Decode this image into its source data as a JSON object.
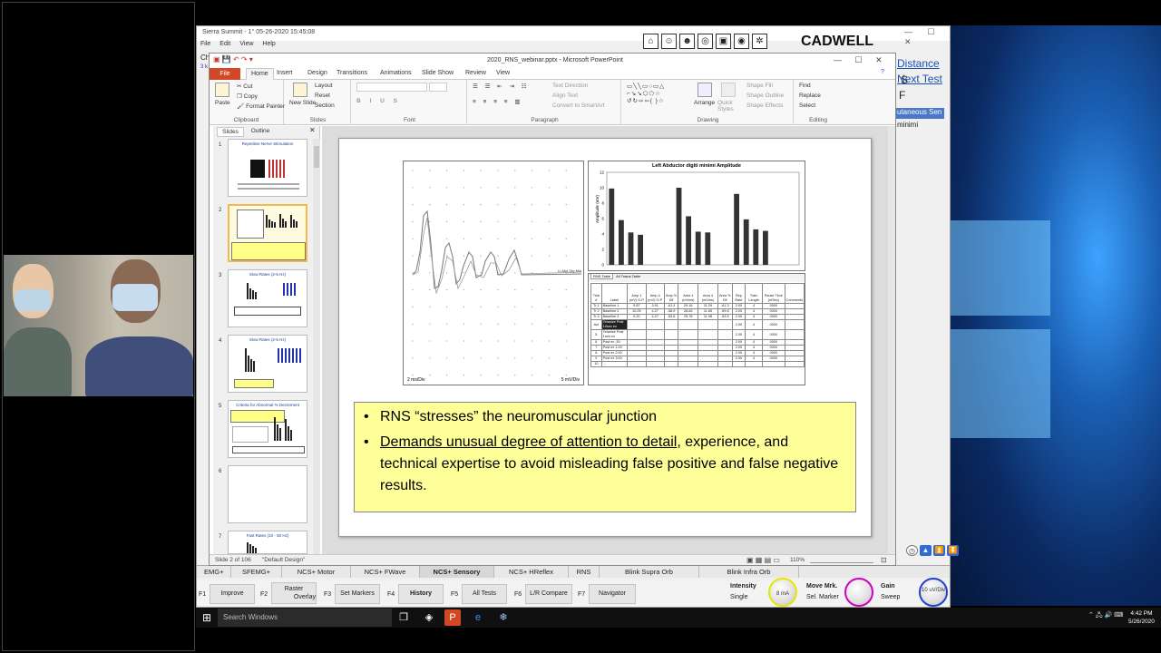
{
  "sierra": {
    "title": "Sierra Summit - 1° 05-26-2020 15:45:08",
    "menu": [
      "File",
      "Edit",
      "View",
      "Help"
    ],
    "logo": "CADWELL",
    "right_links": [
      "Distance",
      "Next Test"
    ],
    "right_side_letters": [
      "S",
      "F"
    ],
    "sensory_tab": "utaneous Sen",
    "minimi": "minimi",
    "mode_tabs": [
      "EMG+",
      "SFEMG+",
      "NCS+ Motor",
      "NCS+ FWave",
      "NCS+ Sensory",
      "NCS+ HReflex",
      "RNS",
      "Blink Supra Orb",
      "Blink Infra Orb"
    ],
    "active_mode": "NCS+ Sensory",
    "fkeys": [
      {
        "key": "F1",
        "label": "Improve"
      },
      {
        "key": "F2",
        "label": "Raster",
        "sub": "Overlay"
      },
      {
        "key": "F3",
        "label": "Set Markers"
      },
      {
        "key": "F4",
        "label": "History"
      },
      {
        "key": "F5",
        "label": "All Tests"
      },
      {
        "key": "F6",
        "label": "L/R Compare"
      },
      {
        "key": "F7",
        "label": "Navigator"
      }
    ],
    "controls": {
      "intensity_label": "Intensity",
      "intensity_mode": "Single",
      "intensity_value": "8 mA",
      "move_label": "Move Mrk.",
      "move_sub": "Sel. Marker",
      "gain_label": "Gain",
      "gain_sub": "Sweep",
      "gain_value": "10 uV/Div"
    },
    "left_fragments": [
      "Ch",
      "3 k"
    ]
  },
  "ppt": {
    "title": "2020_RNS_webinar.pptx - Microsoft PowerPoint",
    "tabs": [
      "File",
      "Home",
      "Insert",
      "Design",
      "Transitions",
      "Animations",
      "Slide Show",
      "Review",
      "View"
    ],
    "ribbon": {
      "clipboard": {
        "label": "Clipboard",
        "paste": "Paste",
        "cut": "Cut",
        "copy": "Copy",
        "format_painter": "Format Painter"
      },
      "slides": {
        "label": "Slides",
        "new_slide": "New Slide",
        "layout": "Layout",
        "reset": "Reset",
        "section": "Section"
      },
      "font": {
        "label": "Font"
      },
      "paragraph": {
        "label": "Paragraph",
        "text_direction": "Text Direction",
        "align_text": "Align Text",
        "smartart": "Convert to SmartArt"
      },
      "drawing": {
        "label": "Drawing",
        "arrange": "Arrange",
        "quick_styles": "Quick Styles",
        "shape_fill": "Shape Fill",
        "shape_outline": "Shape Outline",
        "shape_effects": "Shape Effects"
      },
      "editing": {
        "label": "Editing",
        "find": "Find",
        "replace": "Replace",
        "select": "Select"
      }
    },
    "panel_tabs": [
      "Slides",
      "Outline"
    ],
    "thumbs": [
      {
        "num": "1",
        "title": "Repetitive Nerve Stimulation"
      },
      {
        "num": "2",
        "title": ""
      },
      {
        "num": "3",
        "title": "Slow Rates (2-5 Hz)"
      },
      {
        "num": "4",
        "title": "Slow Rates (2-5 Hz)"
      },
      {
        "num": "5",
        "title": "Criteria for Abnormal % Decrement"
      },
      {
        "num": "6",
        "title": ""
      },
      {
        "num": "7",
        "title": "Fast Rates (10 - 50 Hz)"
      }
    ],
    "slide": {
      "bar_chart_title": "Left Abductor digiti minimi Amplitude",
      "bar_chart_ylabel": "Amplitude (mV)",
      "wave_left_label": "2 ms/Div",
      "wave_right_label": "5 mV/Div",
      "table_tabs": [
        "RNS Table",
        "All Trains Table"
      ],
      "table_headers": [
        "Trial #",
        "Label",
        "Amp 1 (mV) O-P",
        "Amp 4 (mV) O-P",
        "Amp % Dif",
        "Area 1 (mVms)",
        "Area 4 (mVms)",
        "Area % Dif",
        "Rep Rate",
        "Train Length",
        "Pause Time (mSec)",
        "Comments"
      ],
      "table_rows": [
        [
          "Tr 1",
          "Baseline 1",
          "9.87",
          "3.91",
          "-61.4",
          "29.16",
          "11.29",
          "-61.3",
          "2.00",
          "4",
          "0000",
          ""
        ],
        [
          "Tr 2",
          "Baseline 2",
          "10.05",
          "4.27",
          "-58.9",
          "28.65",
          "11.65",
          "-59.8",
          "2.00",
          "4",
          "0000",
          ""
        ],
        [
          "Tr 3",
          "Baseline 3",
          "9.20",
          "4.27",
          "-53.6",
          "25.78",
          "11.98",
          "-53.5",
          "2.00",
          "4",
          "0000",
          ""
        ],
        [
          "Act",
          "Tetanize Post 10sec ex",
          "",
          "",
          "",
          "",
          "",
          "",
          "2.00",
          "4",
          "0000",
          ""
        ],
        [
          "5",
          "Tetanize Post 1min ex",
          "",
          "",
          "",
          "",
          "",
          "",
          "2.00",
          "4",
          "0000",
          ""
        ],
        [
          "6",
          "Post ex :30",
          "",
          "",
          "",
          "",
          "",
          "",
          "2.00",
          "4",
          "0000",
          ""
        ],
        [
          "7",
          "Post ex 1:00",
          "",
          "",
          "",
          "",
          "",
          "",
          "2.00",
          "4",
          "0000",
          ""
        ],
        [
          "8",
          "Post ex 2:00",
          "",
          "",
          "",
          "",
          "",
          "",
          "2.00",
          "4",
          "0000",
          ""
        ],
        [
          "9",
          "Post ex 3:00",
          "",
          "",
          "",
          "",
          "",
          "",
          "2.00",
          "4",
          "0000",
          ""
        ],
        [
          "10",
          "...",
          "",
          "",
          "",
          "",
          "",
          "",
          "",
          "",
          "",
          ""
        ]
      ],
      "bullet1": "RNS “stresses” the neuromuscular junction",
      "bullet2_underlined": "Demands unusual degree of attention to detail",
      "bullet2_rest": ", experience, and technical expertise to avoid misleading false positive and false negative results."
    },
    "status_left": "Slide 2 of 106",
    "status_theme": "\"Default Design\"",
    "zoom": "110%"
  },
  "chart_data": {
    "type": "bar",
    "title": "Left Abductor digiti minimi Amplitude",
    "xlabel": "",
    "ylabel": "Amplitude (mV)",
    "ylim": [
      0,
      12
    ],
    "yticks": [
      0,
      2,
      4,
      6,
      8,
      10,
      12
    ],
    "categories": [
      "1",
      "2",
      "3",
      "4",
      "5",
      "6",
      "7",
      "8",
      "9",
      "10",
      "11",
      "12",
      "13",
      "14",
      "15",
      "16",
      "17",
      "18",
      "19",
      "20"
    ],
    "values": [
      9.9,
      5.8,
      4.2,
      3.9,
      0,
      0,
      0,
      10.0,
      6.3,
      4.3,
      4.2,
      0,
      0,
      9.2,
      5.9,
      4.6,
      4.4,
      0,
      0,
      0
    ]
  },
  "taskbar": {
    "search_placeholder": "Search Windows",
    "time": "4:42 PM",
    "date": "5/26/2020"
  },
  "colors": {
    "textbox_bg": "#ffff99",
    "ppt_file_tab": "#d24726",
    "link_blue": "#1a4fb3"
  }
}
